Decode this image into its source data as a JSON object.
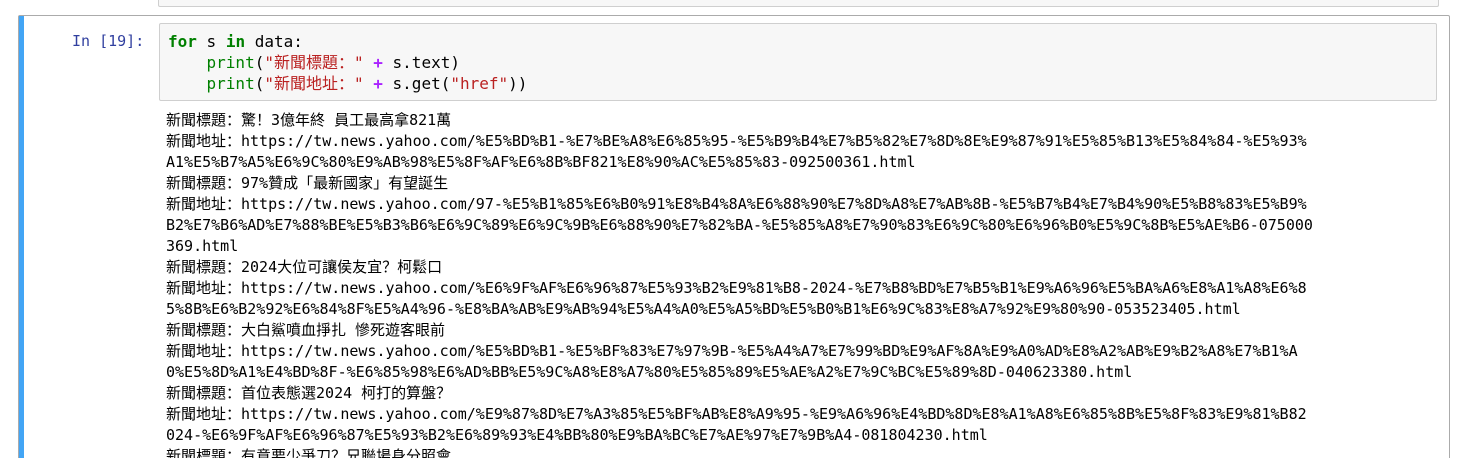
{
  "cell": {
    "prompt": "In [19]:",
    "code": {
      "line1": {
        "kw_for": "for",
        "var": " s ",
        "kw_in": "in",
        "rest": " data:"
      },
      "line2": {
        "indent": "    ",
        "func": "print",
        "open": "(",
        "str": "\"新聞標題：\"",
        "sp1": " ",
        "op": "+",
        "rest": " s.text)"
      },
      "line3": {
        "indent": "    ",
        "func": "print",
        "open": "(",
        "str": "\"新聞地址：\"",
        "sp1": " ",
        "op": "+",
        "mid": " s.get(",
        "str2": "\"href\"",
        "close": "))"
      }
    }
  },
  "output": {
    "lines": [
      "新聞標題：驚！3億年終 員工最高拿821萬",
      "新聞地址：https://tw.news.yahoo.com/%E5%BD%B1-%E7%BE%A8%E6%85%95-%E5%B9%B4%E7%B5%82%E7%8D%8E%E9%87%91%E5%85%B13%E5%84%84-%E5%93%",
      "A1%E5%B7%A5%E6%9C%80%E9%AB%98%E5%8F%AF%E6%8B%BF821%E8%90%AC%E5%85%83-092500361.html",
      "新聞標題：97%贊成「最新國家」有望誕生",
      "新聞地址：https://tw.news.yahoo.com/97-%E5%B1%85%E6%B0%91%E8%B4%8A%E6%88%90%E7%8D%A8%E7%AB%8B-%E5%B7%B4%E7%B4%90%E5%B8%83%E5%B9%",
      "B2%E7%B6%AD%E7%88%BE%E5%B3%B6%E6%9C%89%E6%9C%9B%E6%88%90%E7%82%BA-%E5%85%A8%E7%90%83%E6%9C%80%E6%96%B0%E5%9C%8B%E5%AE%B6-075000",
      "369.html",
      "新聞標題：2024大位可讓侯友宜？柯鬆口",
      "新聞地址：https://tw.news.yahoo.com/%E6%9F%AF%E6%96%87%E5%93%B2%E9%81%B8-2024-%E7%B8%BD%E7%B5%B1%E9%A6%96%E5%BA%A6%E8%A1%A8%E6%8",
      "5%8B%E6%B2%92%E6%84%8F%E5%A4%96-%E8%BA%AB%E9%AB%94%E5%A4%A0%E5%A5%BD%E5%B0%B1%E6%9C%83%E8%A7%92%E9%80%90-053523405.html",
      "新聞標題：大白鯊噴血掙扎 慘死遊客眼前",
      "新聞地址：https://tw.news.yahoo.com/%E5%BD%B1-%E5%BF%83%E7%97%9B-%E5%A4%A7%E7%99%BD%E9%AF%8A%E9%A0%AD%E8%A2%AB%E9%B2%A8%E7%B1%A",
      "0%E5%8D%A1%E4%BD%8F-%E6%85%98%E6%AD%BB%E5%9C%A8%E8%A7%80%E5%85%89%E5%AE%A2%E7%9C%BC%E5%89%8D-040623380.html",
      "新聞標題：首位表態選2024 柯打的算盤？",
      "新聞地址：https://tw.news.yahoo.com/%E9%87%8D%E7%A3%85%E5%BF%AB%E8%A9%95-%E9%A6%96%E4%BD%8D%E8%A1%A8%E6%85%8B%E5%8F%83%E9%81%B82",
      "024-%E6%9F%AF%E6%96%87%E5%93%B2%E6%89%93%E4%BB%80%E9%BA%BC%E7%AE%97%E7%9B%A4-081804230.html",
      "新聞標題：有意要少爭刀？兄聯場身分照會"
    ]
  }
}
